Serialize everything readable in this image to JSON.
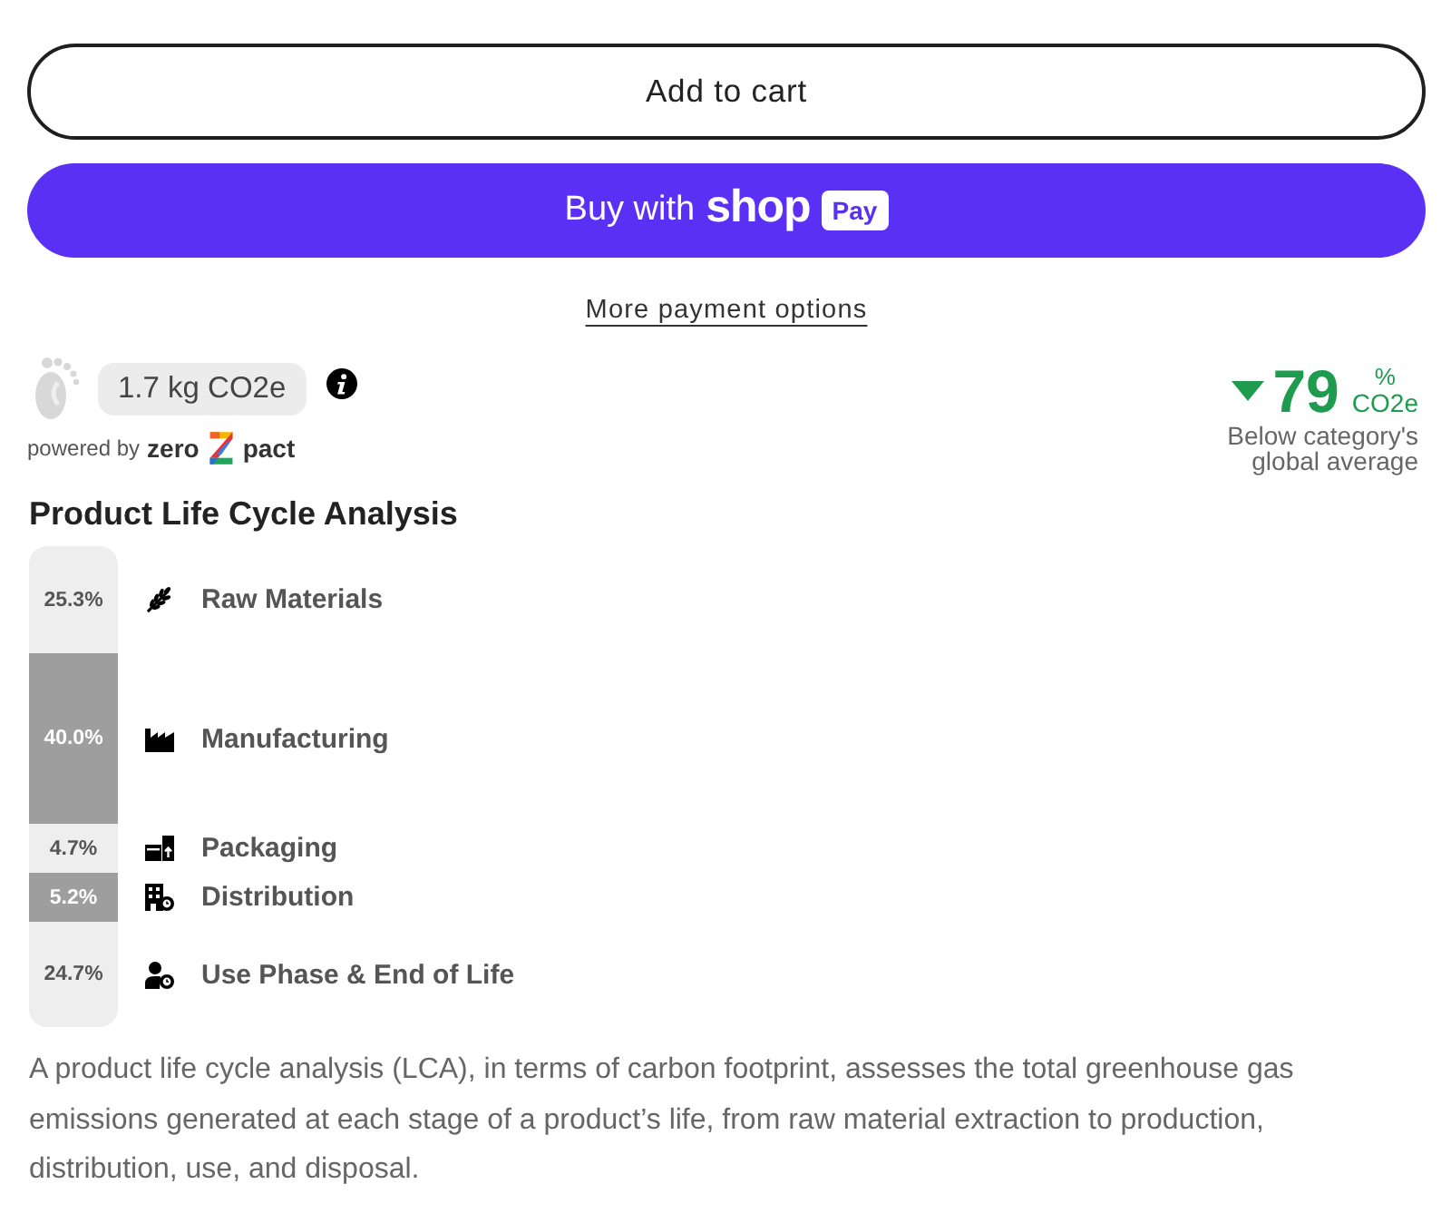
{
  "add_to_cart": {
    "label": "Add to cart"
  },
  "shop_pay": {
    "prefix": "Buy with",
    "brand": "shop",
    "badge": "Pay"
  },
  "more_payment_options": "More payment options",
  "footprint": {
    "value": "1.7 kg CO2e",
    "powered_by": "powered by",
    "brand_left": "zero",
    "brand_right": "pact"
  },
  "comparison": {
    "below_average": true,
    "value": "79",
    "unit_top": "%",
    "unit_bottom": "CO2e",
    "caption": "Below category's global average"
  },
  "life_cycle": {
    "title": "Product Life Cycle Analysis",
    "stages": [
      {
        "kind": "materials",
        "share": "25.3%",
        "label": "Raw Materials"
      },
      {
        "kind": "manufacturing",
        "share": "40.0%",
        "label": "Manufacturing"
      },
      {
        "kind": "packaging",
        "share": "4.7%",
        "label": "Packaging"
      },
      {
        "kind": "distribution",
        "share": "5.2%",
        "label": "Distribution"
      },
      {
        "kind": "use",
        "share": "24.7%",
        "label": "Use Phase & End of Life"
      }
    ]
  },
  "description": "A product life cycle analysis (LCA), in terms of carbon footprint, assesses the total greenhouse gas emissions generated at each stage of a product’s life, from raw material extraction to production, distribution, use, and disposal."
}
